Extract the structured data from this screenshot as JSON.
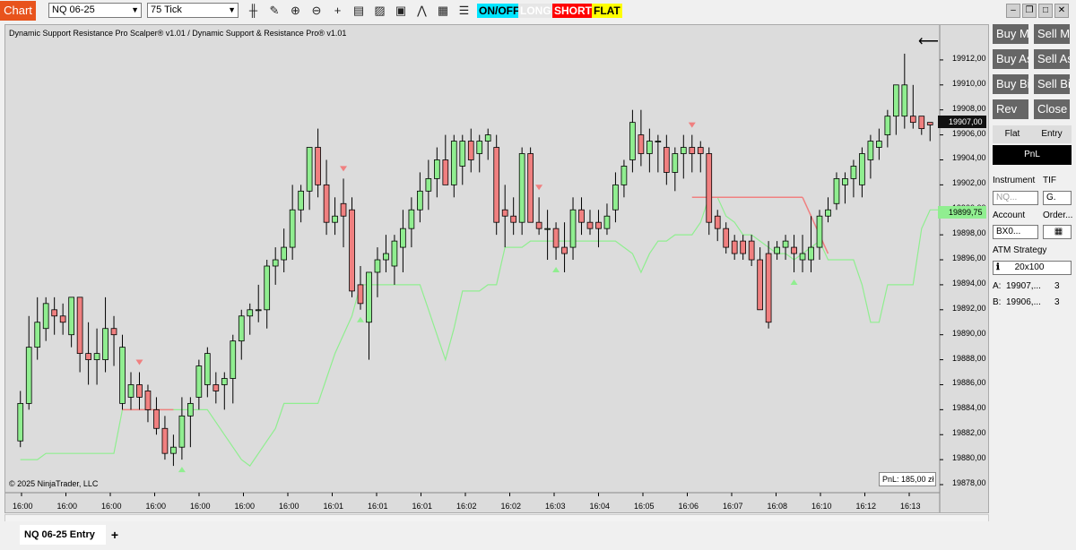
{
  "toolbar": {
    "chart_label": "Chart",
    "instrument": "NQ 06-25",
    "interval": "75 Tick",
    "icons": [
      "bar-style-icon",
      "draw-pencil-icon",
      "zoom-in-icon",
      "zoom-out-icon",
      "crosshair-icon",
      "data-box-icon",
      "templates-icon",
      "chart-trader-icon",
      "indicators-icon",
      "strategies-icon",
      "properties-icon"
    ],
    "tags": [
      {
        "label": "ON/OFF",
        "bg": "#00e5ff",
        "fg": "#000000"
      },
      {
        "label": "LONG",
        "bg": "#e6e6e6",
        "fg": "#ffffff"
      },
      {
        "label": "SHORT",
        "bg": "#ff0000",
        "fg": "#ffffff"
      },
      {
        "label": "FLAT",
        "bg": "#ffff00",
        "fg": "#000000"
      }
    ],
    "window_buttons": [
      "minimize-icon",
      "restore-icon",
      "maximize-icon",
      "close-icon"
    ]
  },
  "chart": {
    "title": "Dynamic Support Resistance Pro Scalper® v1.01 / Dynamic Support & Resistance Pro® v1.01",
    "copyright": "© 2025 NinjaTrader, LLC",
    "pnl": "PnL: 185,00 zł",
    "last_price": "19907,00",
    "support_price": "19899,75",
    "colors": {
      "up": "#90ee90",
      "down": "#f08080",
      "support": "#90ee90",
      "resistance": "#f08080",
      "bg": "#dcdcdc"
    }
  },
  "chart_data": {
    "type": "candlestick",
    "y_ticks": [
      "19912,00",
      "19910,00",
      "19908,00",
      "19906,00",
      "19904,00",
      "19902,00",
      "19900,00",
      "19898,00",
      "19896,00",
      "19894,00",
      "19892,00",
      "19890,00",
      "19888,00",
      "19886,00",
      "19884,00",
      "19882,00",
      "19880,00",
      "19878,00"
    ],
    "ylim": [
      19877.5,
      19913.5
    ],
    "x_ticks": [
      "16:00",
      "16:00",
      "16:00",
      "16:00",
      "16:00",
      "16:00",
      "16:00",
      "16:01",
      "16:01",
      "16:01",
      "16:02",
      "16:02",
      "16:03",
      "16:04",
      "16:05",
      "16:06",
      "16:07",
      "16:08",
      "16:10",
      "16:12",
      "16:13"
    ],
    "candles": [
      {
        "o": 19881.5,
        "h": 19885.5,
        "l": 19881.0,
        "c": 19884.5
      },
      {
        "o": 19884.5,
        "h": 19891.5,
        "l": 19884.0,
        "c": 19889.0
      },
      {
        "o": 19889.0,
        "h": 19893.0,
        "l": 19888.0,
        "c": 19891.0
      },
      {
        "o": 19890.5,
        "h": 19893.0,
        "l": 19889.5,
        "c": 19892.5
      },
      {
        "o": 19892.0,
        "h": 19893.0,
        "l": 19890.0,
        "c": 19891.5
      },
      {
        "o": 19891.5,
        "h": 19892.5,
        "l": 19890.0,
        "c": 19891.0
      },
      {
        "o": 19890.0,
        "h": 19893.0,
        "l": 19889.0,
        "c": 19893.0
      },
      {
        "o": 19893.0,
        "h": 19893.0,
        "l": 19887.0,
        "c": 19888.5
      },
      {
        "o": 19888.5,
        "h": 19891.0,
        "l": 19886.0,
        "c": 19888.0
      },
      {
        "o": 19888.0,
        "h": 19890.5,
        "l": 19886.0,
        "c": 19888.5
      },
      {
        "o": 19888.0,
        "h": 19893.0,
        "l": 19887.0,
        "c": 19890.5
      },
      {
        "o": 19890.5,
        "h": 19891.5,
        "l": 19887.5,
        "c": 19890.0
      },
      {
        "o": 19884.5,
        "h": 19890.0,
        "l": 19884.0,
        "c": 19889.0
      },
      {
        "o": 19885.0,
        "h": 19887.0,
        "l": 19884.0,
        "c": 19886.0
      },
      {
        "o": 19886.0,
        "h": 19887.0,
        "l": 19884.0,
        "c": 19885.0
      },
      {
        "o": 19885.5,
        "h": 19886.0,
        "l": 19883.0,
        "c": 19884.0
      },
      {
        "o": 19884.0,
        "h": 19885.0,
        "l": 19882.0,
        "c": 19882.5
      },
      {
        "o": 19882.5,
        "h": 19883.5,
        "l": 19880.0,
        "c": 19880.5
      },
      {
        "o": 19880.5,
        "h": 19882.0,
        "l": 19879.5,
        "c": 19881.0
      },
      {
        "o": 19881.0,
        "h": 19885.0,
        "l": 19880.0,
        "c": 19883.5
      },
      {
        "o": 19883.5,
        "h": 19885.0,
        "l": 19881.0,
        "c": 19884.5
      },
      {
        "o": 19885.0,
        "h": 19888.0,
        "l": 19884.0,
        "c": 19887.5
      },
      {
        "o": 19886.0,
        "h": 19889.0,
        "l": 19885.0,
        "c": 19888.5
      },
      {
        "o": 19886.0,
        "h": 19887.0,
        "l": 19884.5,
        "c": 19885.5
      },
      {
        "o": 19886.0,
        "h": 19887.0,
        "l": 19884.0,
        "c": 19886.5
      },
      {
        "o": 19886.5,
        "h": 19890.0,
        "l": 19884.5,
        "c": 19889.5
      },
      {
        "o": 19889.5,
        "h": 19892.0,
        "l": 19888.0,
        "c": 19891.5
      },
      {
        "o": 19891.5,
        "h": 19892.5,
        "l": 19890.0,
        "c": 19892.0
      },
      {
        "o": 19892.0,
        "h": 19894.0,
        "l": 19891.0,
        "c": 19892.0
      },
      {
        "o": 19892.0,
        "h": 19896.0,
        "l": 19890.5,
        "c": 19895.5
      },
      {
        "o": 19895.5,
        "h": 19897.0,
        "l": 19894.0,
        "c": 19896.0
      },
      {
        "o": 19896.0,
        "h": 19898.5,
        "l": 19895.0,
        "c": 19897.0
      },
      {
        "o": 19897.0,
        "h": 19902.0,
        "l": 19896.0,
        "c": 19900.0
      },
      {
        "o": 19900.0,
        "h": 19902.0,
        "l": 19899.0,
        "c": 19901.5
      },
      {
        "o": 19901.5,
        "h": 19905.0,
        "l": 19900.0,
        "c": 19905.0
      },
      {
        "o": 19905.0,
        "h": 19906.5,
        "l": 19901.0,
        "c": 19902.0
      },
      {
        "o": 19902.0,
        "h": 19904.0,
        "l": 19898.0,
        "c": 19899.0
      },
      {
        "o": 19899.0,
        "h": 19901.0,
        "l": 19898.0,
        "c": 19899.5
      },
      {
        "o": 19900.5,
        "h": 19902.5,
        "l": 19897.0,
        "c": 19899.5
      },
      {
        "o": 19900.0,
        "h": 19901.0,
        "l": 19893.0,
        "c": 19893.5
      },
      {
        "o": 19894.0,
        "h": 19895.5,
        "l": 19892.0,
        "c": 19892.5
      },
      {
        "o": 19891.0,
        "h": 19895.0,
        "l": 19888.0,
        "c": 19895.0
      },
      {
        "o": 19895.0,
        "h": 19897.0,
        "l": 19893.0,
        "c": 19896.0
      },
      {
        "o": 19896.0,
        "h": 19898.0,
        "l": 19895.0,
        "c": 19896.5
      },
      {
        "o": 19895.5,
        "h": 19898.0,
        "l": 19894.0,
        "c": 19897.5
      },
      {
        "o": 19897.0,
        "h": 19900.0,
        "l": 19895.0,
        "c": 19898.5
      },
      {
        "o": 19898.5,
        "h": 19901.0,
        "l": 19897.0,
        "c": 19900.0
      },
      {
        "o": 19900.0,
        "h": 19903.0,
        "l": 19899.0,
        "c": 19901.5
      },
      {
        "o": 19901.5,
        "h": 19904.0,
        "l": 19900.0,
        "c": 19902.5
      },
      {
        "o": 19902.5,
        "h": 19905.0,
        "l": 19901.0,
        "c": 19904.0
      },
      {
        "o": 19904.0,
        "h": 19906.0,
        "l": 19903.0,
        "c": 19902.0
      },
      {
        "o": 19902.0,
        "h": 19906.0,
        "l": 19901.0,
        "c": 19905.5
      },
      {
        "o": 19903.5,
        "h": 19906.0,
        "l": 19902.0,
        "c": 19905.5
      },
      {
        "o": 19905.5,
        "h": 19906.5,
        "l": 19903.0,
        "c": 19904.0
      },
      {
        "o": 19904.5,
        "h": 19906.0,
        "l": 19903.0,
        "c": 19905.5
      },
      {
        "o": 19905.5,
        "h": 19906.5,
        "l": 19904.0,
        "c": 19906.0
      },
      {
        "o": 19905.0,
        "h": 19906.0,
        "l": 19898.0,
        "c": 19899.0
      },
      {
        "o": 19900.0,
        "h": 19902.0,
        "l": 19897.0,
        "c": 19899.5
      },
      {
        "o": 19899.5,
        "h": 19901.0,
        "l": 19898.0,
        "c": 19899.0
      },
      {
        "o": 19899.0,
        "h": 19905.0,
        "l": 19898.0,
        "c": 19904.5
      },
      {
        "o": 19904.5,
        "h": 19905.0,
        "l": 19899.0,
        "c": 19899.0
      },
      {
        "o": 19899.0,
        "h": 19901.0,
        "l": 19898.0,
        "c": 19898.5
      },
      {
        "o": 19898.5,
        "h": 19900.0,
        "l": 19896.0,
        "c": 19898.5
      },
      {
        "o": 19898.5,
        "h": 19899.0,
        "l": 19896.0,
        "c": 19897.0
      },
      {
        "o": 19897.0,
        "h": 19899.0,
        "l": 19895.0,
        "c": 19896.5
      },
      {
        "o": 19897.0,
        "h": 19901.0,
        "l": 19896.0,
        "c": 19900.0
      },
      {
        "o": 19900.0,
        "h": 19901.0,
        "l": 19898.0,
        "c": 19899.0
      },
      {
        "o": 19899.0,
        "h": 19900.0,
        "l": 19898.0,
        "c": 19898.5
      },
      {
        "o": 19899.0,
        "h": 19900.0,
        "l": 19897.0,
        "c": 19898.5
      },
      {
        "o": 19898.5,
        "h": 19900.5,
        "l": 19898.0,
        "c": 19899.5
      },
      {
        "o": 19900.0,
        "h": 19903.0,
        "l": 19899.0,
        "c": 19902.0
      },
      {
        "o": 19902.0,
        "h": 19904.0,
        "l": 19901.0,
        "c": 19903.5
      },
      {
        "o": 19904.0,
        "h": 19908.0,
        "l": 19903.0,
        "c": 19907.0
      },
      {
        "o": 19906.0,
        "h": 19908.0,
        "l": 19903.5,
        "c": 19904.5
      },
      {
        "o": 19904.5,
        "h": 19906.5,
        "l": 19903.0,
        "c": 19905.5
      },
      {
        "o": 19905.5,
        "h": 19906.0,
        "l": 19903.0,
        "c": 19905.5
      },
      {
        "o": 19905.0,
        "h": 19906.0,
        "l": 19902.0,
        "c": 19903.0
      },
      {
        "o": 19903.0,
        "h": 19905.0,
        "l": 19901.5,
        "c": 19904.5
      },
      {
        "o": 19904.5,
        "h": 19906.0,
        "l": 19902.5,
        "c": 19905.0
      },
      {
        "o": 19905.0,
        "h": 19906.0,
        "l": 19903.0,
        "c": 19904.5
      },
      {
        "o": 19905.0,
        "h": 19905.5,
        "l": 19903.0,
        "c": 19904.5
      },
      {
        "o": 19904.5,
        "h": 19905.0,
        "l": 19898.0,
        "c": 19899.0
      },
      {
        "o": 19899.5,
        "h": 19900.0,
        "l": 19897.5,
        "c": 19898.5
      },
      {
        "o": 19898.5,
        "h": 19899.0,
        "l": 19896.5,
        "c": 19897.0
      },
      {
        "o": 19897.5,
        "h": 19898.0,
        "l": 19896.0,
        "c": 19896.5
      },
      {
        "o": 19897.5,
        "h": 19898.0,
        "l": 19896.0,
        "c": 19896.5
      },
      {
        "o": 19897.5,
        "h": 19898.0,
        "l": 19895.5,
        "c": 19896.0
      },
      {
        "o": 19896.0,
        "h": 19897.0,
        "l": 19892.0,
        "c": 19892.0
      },
      {
        "o": 19896.5,
        "h": 19897.5,
        "l": 19890.5,
        "c": 19891.0
      },
      {
        "o": 19896.5,
        "h": 19897.5,
        "l": 19896.0,
        "c": 19897.0
      },
      {
        "o": 19897.0,
        "h": 19898.0,
        "l": 19896.0,
        "c": 19897.5
      },
      {
        "o": 19897.0,
        "h": 19898.0,
        "l": 19895.0,
        "c": 19896.5
      },
      {
        "o": 19896.0,
        "h": 19898.0,
        "l": 19895.0,
        "c": 19896.5
      },
      {
        "o": 19896.0,
        "h": 19899.5,
        "l": 19895.0,
        "c": 19897.0
      },
      {
        "o": 19897.0,
        "h": 19900.0,
        "l": 19896.0,
        "c": 19899.5
      },
      {
        "o": 19899.5,
        "h": 19901.0,
        "l": 19899.0,
        "c": 19900.0
      },
      {
        "o": 19900.5,
        "h": 19903.0,
        "l": 19900.0,
        "c": 19902.5
      },
      {
        "o": 19902.0,
        "h": 19903.0,
        "l": 19900.5,
        "c": 19902.5
      },
      {
        "o": 19902.5,
        "h": 19904.0,
        "l": 19901.0,
        "c": 19903.5
      },
      {
        "o": 19902.0,
        "h": 19905.0,
        "l": 19901.0,
        "c": 19904.5
      },
      {
        "o": 19904.0,
        "h": 19906.0,
        "l": 19902.5,
        "c": 19905.5
      },
      {
        "o": 19905.0,
        "h": 19906.5,
        "l": 19904.0,
        "c": 19905.5
      },
      {
        "o": 19906.0,
        "h": 19908.0,
        "l": 19905.0,
        "c": 19907.5
      },
      {
        "o": 19907.5,
        "h": 19910.0,
        "l": 19906.0,
        "c": 19910.0
      },
      {
        "o": 19907.5,
        "h": 19912.5,
        "l": 19906.5,
        "c": 19910.0
      },
      {
        "o": 19907.5,
        "h": 19910.0,
        "l": 19906.5,
        "c": 19907.0
      },
      {
        "o": 19907.5,
        "h": 19907.5,
        "l": 19906.0,
        "c": 19906.5
      },
      {
        "o": 19907.0,
        "h": 19907.0,
        "l": 19905.5,
        "c": 19906.8
      }
    ],
    "support_line": [
      19880.0,
      19880.0,
      19880.0,
      19880.5,
      19880.5,
      19880.5,
      19880.5,
      19880.5,
      19880.5,
      19880.5,
      19880.5,
      19880.5,
      19884.0,
      19884.0,
      19884.0,
      19884.0,
      19884.0,
      19884.0,
      19884.0,
      19884.0,
      19884.0,
      19884.0,
      19884.0,
      19883.0,
      19882.0,
      19881.0,
      19880.0,
      19879.5,
      19880.5,
      19881.5,
      19882.5,
      19884.5,
      19884.5,
      19884.5,
      19884.5,
      19884.5,
      19886.5,
      19888.5,
      19890.0,
      19891.5,
      19894.0,
      19894.0,
      19894.0,
      19894.0,
      19894.0,
      19894.0,
      19894.0,
      19894.0,
      19892.0,
      19890.0,
      19888.0,
      19890.5,
      19893.5,
      19893.5,
      19893.5,
      19894.0,
      19894.0,
      19897.0,
      19897.0,
      19897.0,
      19897.5,
      19897.5,
      19897.5,
      19897.5,
      19897.5,
      19897.5,
      19897.5,
      19897.5,
      19897.5,
      19897.5,
      19897.5,
      19897.0,
      19896.5,
      19895.0,
      19896.5,
      19897.5,
      19897.5,
      19898.0,
      19898.0,
      19898.0,
      19899.0,
      19901.0,
      19901.0,
      19899.5,
      19899.0,
      19898.0,
      19898.0,
      19897.5,
      19897.0,
      19896.5,
      19896.5,
      19896.0,
      19896.5,
      19897.0,
      19897.5,
      19896.0,
      19896.0,
      19896.0,
      19896.0,
      19894.0,
      19891.0,
      19891.0,
      19894.0,
      19894.0,
      19894.0,
      19894.0,
      19898.5,
      19900.0,
      19900.0
    ],
    "resistance_segments": [
      {
        "from": 12,
        "to": 18,
        "value": 19884.0
      },
      {
        "from": 79,
        "to": 92,
        "value": 19901.0
      }
    ],
    "sell_arrows": [
      14,
      38,
      61,
      79
    ],
    "buy_arrows": [
      19,
      40,
      63,
      91
    ]
  },
  "side": {
    "buttons": [
      "Buy Mkt",
      "Sell Mkt",
      "Buy Ask",
      "Sell Ask",
      "Buy Bid",
      "Sell Bid",
      "Rev",
      "Close"
    ],
    "tabs": [
      "Flat",
      "Entry"
    ],
    "pnl_label": "PnL",
    "instrument_label": "Instrument",
    "tif_label": "TIF",
    "instrument_value": "NQ...",
    "tif_value": "G.",
    "account_label": "Account",
    "order_label": "Order...",
    "account_value": "BX0...",
    "atm_label": "ATM Strategy",
    "atm_value": "20x100",
    "ask_label": "A:",
    "ask_price": "19907,...",
    "ask_qty": "3",
    "bid_label": "B:",
    "bid_price": "19906,...",
    "bid_qty": "3"
  },
  "tabs": {
    "active": "NQ 06-25 Entry",
    "add": "+"
  }
}
